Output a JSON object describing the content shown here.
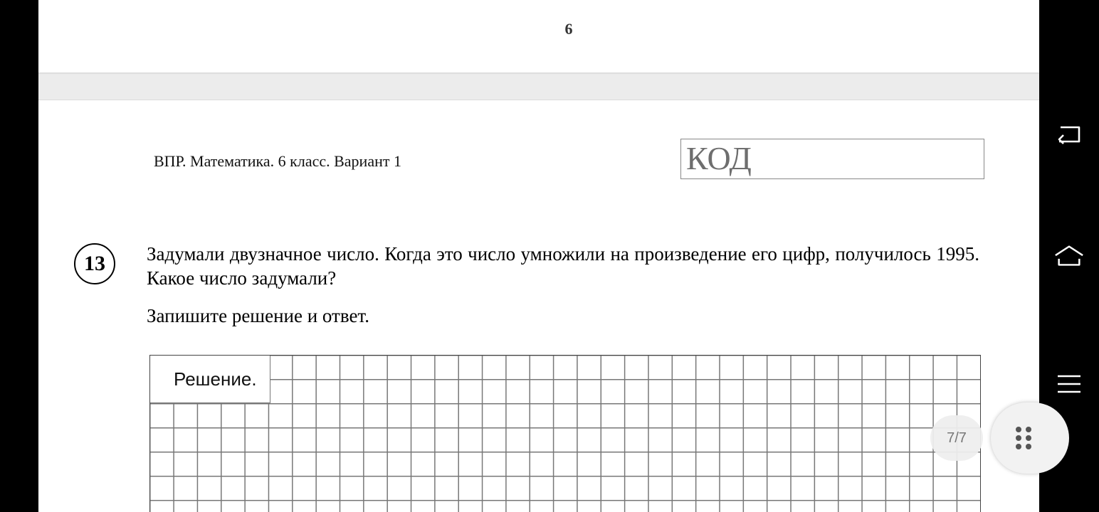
{
  "document": {
    "page_number": "6",
    "header": "ВПР. Математика. 6 класс. Вариант 1",
    "code_label": "КОД",
    "task": {
      "number": "13",
      "text": "Задумали двузначное число. Когда это число умножили на произведение его цифр, получилось 1995. Какое число задумали?",
      "instruction": "Запишите решение и ответ.",
      "solution_label": "Решение."
    }
  },
  "viewer": {
    "page_indicator": "7/7",
    "icons": {
      "back": "back-icon",
      "home": "home-icon",
      "menu": "menu-icon",
      "floating": "grid-dots-icon"
    }
  }
}
